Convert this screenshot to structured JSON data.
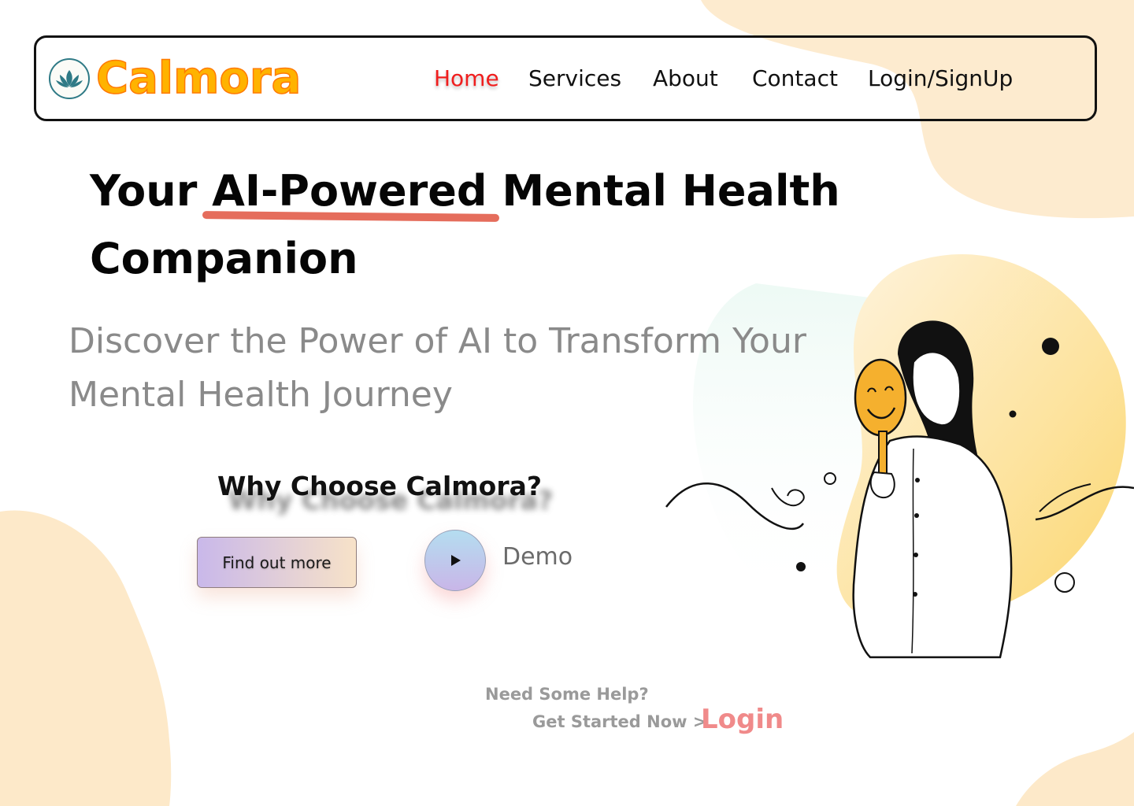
{
  "brand": {
    "name": "Calmora",
    "logo_icon": "lotus-icon"
  },
  "nav": {
    "items": [
      {
        "label": "Home",
        "active": true
      },
      {
        "label": "Services",
        "active": false
      },
      {
        "label": "About",
        "active": false
      },
      {
        "label": "Contact",
        "active": false
      },
      {
        "label": "Login/SignUp",
        "active": false
      }
    ]
  },
  "hero": {
    "title_part1": "Your ",
    "title_highlight": "AI-Powered",
    "title_part2": " Mental Health",
    "title_line2": "Companion",
    "subtitle": "Discover the Power of AI to Transform Your Mental Health Journey"
  },
  "why": {
    "heading": "Why Choose Calmora?"
  },
  "actions": {
    "find_out_more": "Find out more",
    "demo_label": "Demo",
    "play_icon": "play-icon"
  },
  "footer_cta": {
    "help_text": "Need Some Help?",
    "get_started": "Get Started Now >",
    "login": "Login"
  },
  "colors": {
    "brand_orange": "#ffb300",
    "active_nav": "#f01e1e",
    "highlight_stroke": "#e0543f",
    "blob_cream": "#fde9c9",
    "login_pink": "#f08a8a"
  }
}
